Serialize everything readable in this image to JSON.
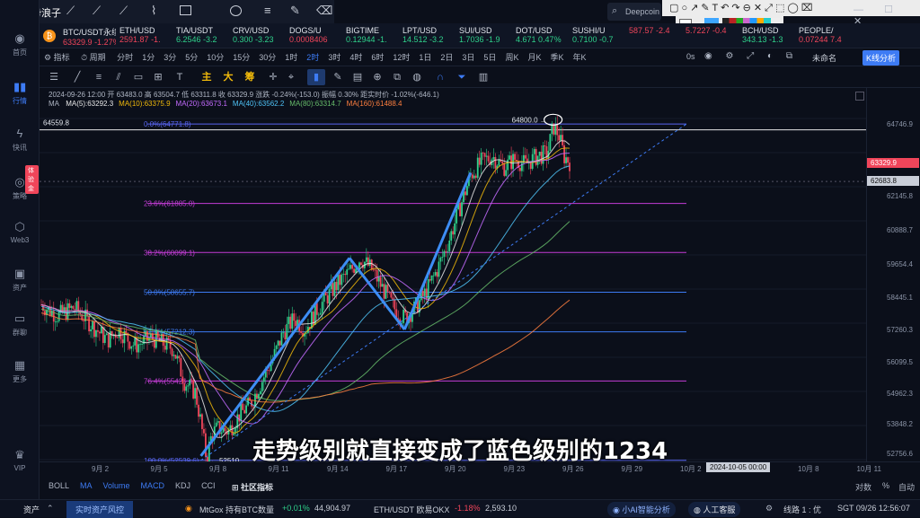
{
  "window": {
    "app_title": "趋势浪子"
  },
  "search": {
    "placeholder": "Deepcoin"
  },
  "sidebar": [
    {
      "label": "首页",
      "icon": "globe-icon"
    },
    {
      "label": "行情",
      "icon": "bar-chart-icon",
      "active": true
    },
    {
      "label": "快讯",
      "icon": "lightning-icon"
    },
    {
      "label": "策略",
      "icon": "target-icon"
    },
    {
      "label": "Web3",
      "icon": "web3-icon"
    },
    {
      "label": "资产",
      "icon": "wallet-icon"
    },
    {
      "label": "群聊",
      "icon": "chat-icon"
    },
    {
      "label": "更多",
      "icon": "grid-icon"
    },
    {
      "label": "VIP",
      "icon": "vip-icon"
    }
  ],
  "sidebar_badge": "体验金",
  "tickers": [
    {
      "name": "BTC/USDT永续",
      "price": "63329.9",
      "chg": "-1.27%",
      "dir": "dn"
    },
    {
      "name": "ETH/USD",
      "price": "2591.87",
      "chg": "-1.",
      "dir": "dn"
    },
    {
      "name": "TIA/USDT",
      "price": "6.2546",
      "chg": "-3.2",
      "dir": "up"
    },
    {
      "name": "CRV/USD",
      "price": "0.300",
      "chg": "-3.23",
      "dir": "up"
    },
    {
      "name": "DOGS/U",
      "price": "0.0008406",
      "chg": "",
      "dir": "dn"
    },
    {
      "name": "BIGTIME",
      "price": "0.12944",
      "chg": "-1.",
      "dir": "up"
    },
    {
      "name": "LPT/USD",
      "price": "14.512",
      "chg": "-3.2",
      "dir": "up"
    },
    {
      "name": "SUI/USD",
      "price": "1.7036",
      "chg": "-1.9",
      "dir": "up"
    },
    {
      "name": "DOT/USD",
      "price": "4.671",
      "chg": "0.47%",
      "dir": "up"
    },
    {
      "name": "SUSHI/U",
      "price": "0.7100",
      "chg": "-0.7",
      "dir": "up"
    },
    {
      "name": "",
      "price": "587.57",
      "chg": "-2.4",
      "dir": "dn"
    },
    {
      "name": "",
      "price": "5.7227",
      "chg": "-0.4",
      "dir": "dn"
    },
    {
      "name": "BCH/USD",
      "price": "343.13",
      "chg": "-1.3",
      "dir": "up"
    },
    {
      "name": "PEOPLE/",
      "price": "0.07244",
      "chg": "7.4",
      "dir": "dn"
    }
  ],
  "toolbar": {
    "indicators": "指标",
    "period": "周期",
    "timeframes": [
      "分时",
      "1分",
      "3分",
      "5分",
      "10分",
      "15分",
      "30分",
      "1时",
      "2时",
      "3时",
      "4时",
      "6时",
      "12时",
      "1日",
      "2日",
      "3日",
      "5日",
      "周K",
      "月K",
      "季K",
      "年K"
    ],
    "selected_tf": "2时",
    "countdown": "0s",
    "layout_name": "未命名",
    "analysis_btn": "K线分析",
    "main": "主",
    "big": "大",
    "chip": "筹"
  },
  "info": {
    "line1": "2024-09-26 12:00  开 63483.0  高 63504.7  低 63311.8  收 63329.9  涨跌 -0.24%(-153.0)  振幅 0.30%  距实时价 -1.02%(-646.1)",
    "ma_label": "MA",
    "ma": [
      {
        "t": "MA(5):63292.3",
        "c": "#e8e8e8"
      },
      {
        "t": "MA(10):63375.9",
        "c": "#f0b90b"
      },
      {
        "t": "MA(20):63673.1",
        "c": "#c46bff"
      },
      {
        "t": "MA(40):63562.2",
        "c": "#4fc3f7"
      },
      {
        "t": "MA(80):63314.7",
        "c": "#66bb6a"
      },
      {
        "t": "MA(160):61488.4",
        "c": "#ff7f3f"
      }
    ]
  },
  "chart_data": {
    "type": "candlestick",
    "title": "BTC/USDT永续 2时",
    "x_ticks": [
      "9月 2",
      "9月 5",
      "9月 8",
      "9月 11",
      "9月 14",
      "9月 17",
      "9月 20",
      "9月 23",
      "9月 26",
      "9月 29",
      "10月 2",
      "10月 5",
      "10月 8",
      "10月 11"
    ],
    "crosshair_date": "2024-10-05 00:00",
    "y_ticks": [
      "64746.9",
      "63329.9",
      "62145.8",
      "60888.7",
      "59654.4",
      "58445.1",
      "57260.3",
      "56099.5",
      "54962.3",
      "53848.2",
      "52756.6"
    ],
    "price_label": "63329.9",
    "crosshair_price": "62683.8",
    "y_range": [
      52500,
      65300
    ],
    "high_label": "64559.8",
    "peak_label": "64800.0",
    "low_label": "52510",
    "fib": [
      {
        "label": "0.0%(64771.8)",
        "v": 64771.8,
        "c": "#5865f2"
      },
      {
        "label": "23.6%(61885.0)",
        "v": 61885.0,
        "c": "#c43dd6"
      },
      {
        "label": "38.2%(60099.1)",
        "v": 60099.1,
        "c": "#c43dd6"
      },
      {
        "label": "50.0%(58655.7)",
        "v": 58655.7,
        "c": "#3d7bf4"
      },
      {
        "label": "61.8%(57212.3)",
        "v": 57212.3,
        "c": "#3d7bf4"
      },
      {
        "label": "76.4%(55426.4)",
        "v": 55426.4,
        "c": "#c43dd6"
      },
      {
        "label": "100.0%(52539.6)",
        "v": 52539.6,
        "c": "#5865f2"
      }
    ],
    "close_path": [
      [
        0,
        58200
      ],
      [
        3,
        57800
      ],
      [
        6,
        58100
      ],
      [
        9,
        57500
      ],
      [
        12,
        56900
      ],
      [
        14,
        57300
      ],
      [
        17,
        56700
      ],
      [
        20,
        57000
      ],
      [
        24,
        56600
      ],
      [
        26,
        55400
      ],
      [
        28,
        55000
      ],
      [
        29,
        53900
      ],
      [
        30,
        52600
      ],
      [
        31,
        53500
      ],
      [
        32,
        53700
      ],
      [
        34,
        53600
      ],
      [
        36,
        54200
      ],
      [
        38,
        54600
      ],
      [
        40,
        55400
      ],
      [
        42,
        56200
      ],
      [
        44,
        57200
      ],
      [
        46,
        57700
      ],
      [
        48,
        57300
      ],
      [
        50,
        58000
      ],
      [
        52,
        58500
      ],
      [
        54,
        59000
      ],
      [
        56,
        59400
      ],
      [
        58,
        59900
      ],
      [
        60,
        59500
      ],
      [
        62,
        58800
      ],
      [
        64,
        58100
      ],
      [
        66,
        57700
      ],
      [
        68,
        58100
      ],
      [
        70,
        58700
      ],
      [
        72,
        59500
      ],
      [
        74,
        60500
      ],
      [
        76,
        61700
      ],
      [
        78,
        62900
      ],
      [
        80,
        63400
      ],
      [
        82,
        63600
      ],
      [
        84,
        63200
      ],
      [
        86,
        63500
      ],
      [
        88,
        63300
      ],
      [
        90,
        63600
      ],
      [
        92,
        63700
      ],
      [
        93,
        64700
      ],
      [
        94,
        64400
      ],
      [
        95,
        63600
      ],
      [
        96,
        63400
      ]
    ]
  },
  "subtitle": "走势级别就直接变成了蓝色级别的1234",
  "indicator_bar": {
    "items": [
      "BOLL",
      "MA",
      "Volume",
      "MACD",
      "KDJ",
      "CCI"
    ],
    "community": "社区指标",
    "right": [
      "对数",
      "%",
      "自动"
    ]
  },
  "status": {
    "assets": "资产",
    "risk": "实时资产风控",
    "ticker1": "MtGox 持有BTC数量",
    "t1_chg": "+0.01%",
    "t1_val": "44,904.97",
    "ticker2": "ETH/USDT 欧易OKX",
    "t2_chg": "-1.18%",
    "t2_val": "2,593.10",
    "ai": "小AI智能分析",
    "support": "人工客服",
    "line": "线路 1 : 优",
    "time": "SGT 09/26 12:56:07"
  }
}
